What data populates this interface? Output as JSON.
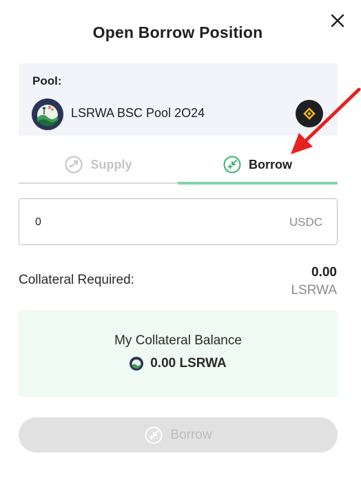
{
  "modal": {
    "title": "Open Borrow Position",
    "close_icon": "close-icon"
  },
  "pool": {
    "label": "Pool:",
    "name": "LSRWA BSC Pool 2O24",
    "avatar_icon": "lsrwa-logo-icon",
    "chain_icon": "bnb-chain-icon"
  },
  "tabs": [
    {
      "label": "Supply",
      "icon": "supply-icon",
      "active": false
    },
    {
      "label": "Borrow",
      "icon": "borrow-icon",
      "active": true
    }
  ],
  "amount": {
    "value": "0",
    "unit": "USDC"
  },
  "collateral": {
    "label": "Collateral Required:",
    "value": "0.00",
    "unit": "LSRWA"
  },
  "balance": {
    "title": "My Collateral Balance",
    "value": "0.00 LSRWA",
    "icon": "lsrwa-token-icon"
  },
  "action": {
    "label": "Borrow",
    "enabled": false
  },
  "colors": {
    "accent": "#7fd4a7",
    "balance_bg": "#eefaf3",
    "pool_bg": "#f3f4f9",
    "chain_yellow": "#f0b90b",
    "annotation_red": "#e52220"
  }
}
